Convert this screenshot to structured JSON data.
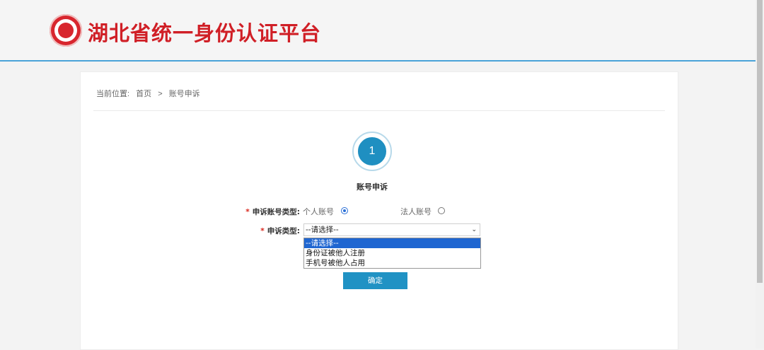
{
  "header": {
    "site_title": "湖北省统一身份认证平台"
  },
  "breadcrumb": {
    "prefix": "当前位置:",
    "home": "首页",
    "separator": ">",
    "current": "账号申诉"
  },
  "steps": [
    {
      "number": "1",
      "label": "账号申诉"
    }
  ],
  "form": {
    "account_type": {
      "label": "申诉账号类型:",
      "options": [
        {
          "label": "个人账号",
          "checked": true
        },
        {
          "label": "法人账号",
          "checked": false
        }
      ]
    },
    "appeal_type": {
      "label": "申诉类型:",
      "selected": "--请选择--",
      "options": [
        "--请选择--",
        "身份证被他人注册",
        "手机号被他人占用"
      ]
    },
    "required_mark": "*",
    "submit_label": "确定"
  },
  "colors": {
    "brand_red": "#d01f26",
    "accent_blue": "#2092c4"
  }
}
